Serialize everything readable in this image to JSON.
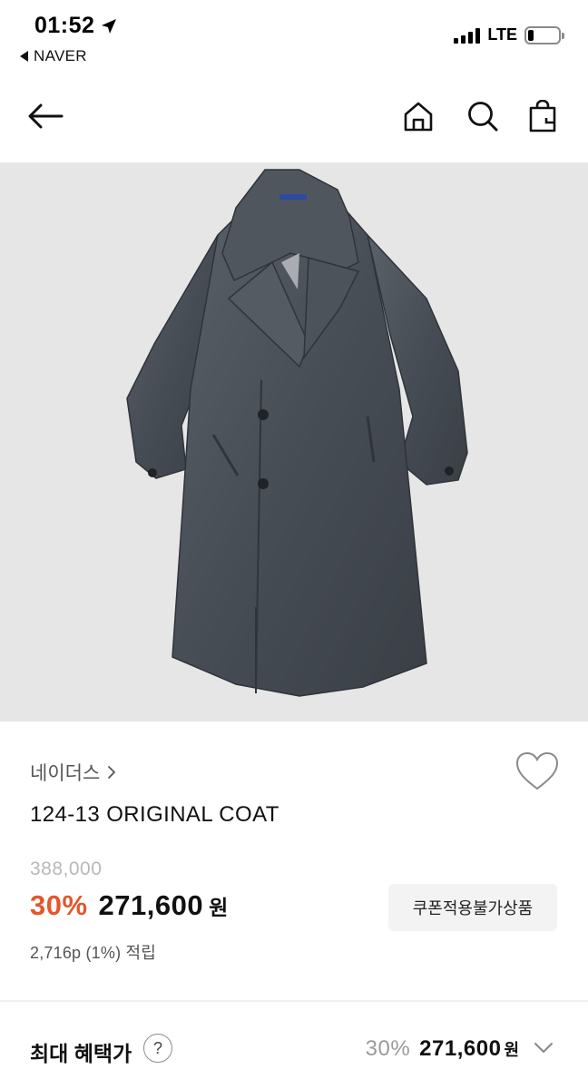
{
  "status_bar": {
    "time": "01:52",
    "back_app": "NAVER",
    "network": "LTE",
    "battery_level": 0.2
  },
  "nav": {
    "icons": [
      "back-arrow-icon",
      "home-icon",
      "search-icon",
      "shopping-bag-icon"
    ]
  },
  "product": {
    "brand": "네이더스",
    "name": "124-13 ORIGINAL COAT",
    "original_price": "388,000",
    "discount": "30%",
    "sale_price": "271,600",
    "currency": "원",
    "coupon_note": "쿠폰적용불가상품",
    "points": "2,716p (1%) 적립"
  },
  "benefit": {
    "label": "최대 혜택가",
    "help": "?",
    "discount": "30%",
    "price": "271,600",
    "currency": "원"
  },
  "colors": {
    "accent": "#e2572b",
    "image_bg": "#e6e6e6"
  }
}
